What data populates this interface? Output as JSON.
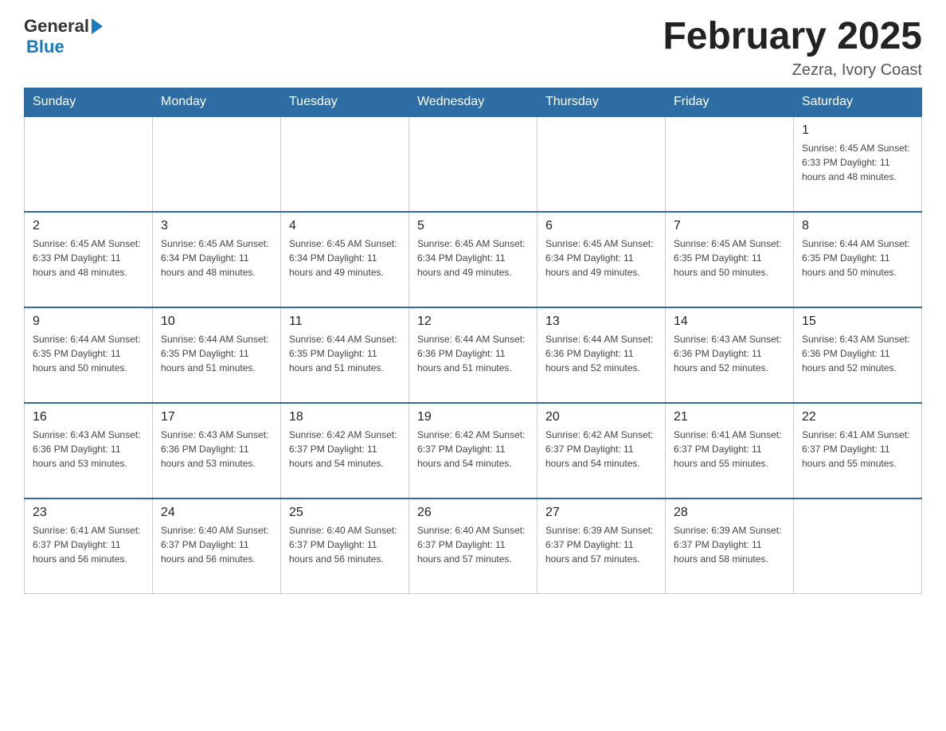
{
  "logo": {
    "general": "General",
    "blue": "Blue"
  },
  "title": "February 2025",
  "subtitle": "Zezra, Ivory Coast",
  "days_of_week": [
    "Sunday",
    "Monday",
    "Tuesday",
    "Wednesday",
    "Thursday",
    "Friday",
    "Saturday"
  ],
  "weeks": [
    [
      {
        "day": "",
        "info": ""
      },
      {
        "day": "",
        "info": ""
      },
      {
        "day": "",
        "info": ""
      },
      {
        "day": "",
        "info": ""
      },
      {
        "day": "",
        "info": ""
      },
      {
        "day": "",
        "info": ""
      },
      {
        "day": "1",
        "info": "Sunrise: 6:45 AM\nSunset: 6:33 PM\nDaylight: 11 hours\nand 48 minutes."
      }
    ],
    [
      {
        "day": "2",
        "info": "Sunrise: 6:45 AM\nSunset: 6:33 PM\nDaylight: 11 hours\nand 48 minutes."
      },
      {
        "day": "3",
        "info": "Sunrise: 6:45 AM\nSunset: 6:34 PM\nDaylight: 11 hours\nand 48 minutes."
      },
      {
        "day": "4",
        "info": "Sunrise: 6:45 AM\nSunset: 6:34 PM\nDaylight: 11 hours\nand 49 minutes."
      },
      {
        "day": "5",
        "info": "Sunrise: 6:45 AM\nSunset: 6:34 PM\nDaylight: 11 hours\nand 49 minutes."
      },
      {
        "day": "6",
        "info": "Sunrise: 6:45 AM\nSunset: 6:34 PM\nDaylight: 11 hours\nand 49 minutes."
      },
      {
        "day": "7",
        "info": "Sunrise: 6:45 AM\nSunset: 6:35 PM\nDaylight: 11 hours\nand 50 minutes."
      },
      {
        "day": "8",
        "info": "Sunrise: 6:44 AM\nSunset: 6:35 PM\nDaylight: 11 hours\nand 50 minutes."
      }
    ],
    [
      {
        "day": "9",
        "info": "Sunrise: 6:44 AM\nSunset: 6:35 PM\nDaylight: 11 hours\nand 50 minutes."
      },
      {
        "day": "10",
        "info": "Sunrise: 6:44 AM\nSunset: 6:35 PM\nDaylight: 11 hours\nand 51 minutes."
      },
      {
        "day": "11",
        "info": "Sunrise: 6:44 AM\nSunset: 6:35 PM\nDaylight: 11 hours\nand 51 minutes."
      },
      {
        "day": "12",
        "info": "Sunrise: 6:44 AM\nSunset: 6:36 PM\nDaylight: 11 hours\nand 51 minutes."
      },
      {
        "day": "13",
        "info": "Sunrise: 6:44 AM\nSunset: 6:36 PM\nDaylight: 11 hours\nand 52 minutes."
      },
      {
        "day": "14",
        "info": "Sunrise: 6:43 AM\nSunset: 6:36 PM\nDaylight: 11 hours\nand 52 minutes."
      },
      {
        "day": "15",
        "info": "Sunrise: 6:43 AM\nSunset: 6:36 PM\nDaylight: 11 hours\nand 52 minutes."
      }
    ],
    [
      {
        "day": "16",
        "info": "Sunrise: 6:43 AM\nSunset: 6:36 PM\nDaylight: 11 hours\nand 53 minutes."
      },
      {
        "day": "17",
        "info": "Sunrise: 6:43 AM\nSunset: 6:36 PM\nDaylight: 11 hours\nand 53 minutes."
      },
      {
        "day": "18",
        "info": "Sunrise: 6:42 AM\nSunset: 6:37 PM\nDaylight: 11 hours\nand 54 minutes."
      },
      {
        "day": "19",
        "info": "Sunrise: 6:42 AM\nSunset: 6:37 PM\nDaylight: 11 hours\nand 54 minutes."
      },
      {
        "day": "20",
        "info": "Sunrise: 6:42 AM\nSunset: 6:37 PM\nDaylight: 11 hours\nand 54 minutes."
      },
      {
        "day": "21",
        "info": "Sunrise: 6:41 AM\nSunset: 6:37 PM\nDaylight: 11 hours\nand 55 minutes."
      },
      {
        "day": "22",
        "info": "Sunrise: 6:41 AM\nSunset: 6:37 PM\nDaylight: 11 hours\nand 55 minutes."
      }
    ],
    [
      {
        "day": "23",
        "info": "Sunrise: 6:41 AM\nSunset: 6:37 PM\nDaylight: 11 hours\nand 56 minutes."
      },
      {
        "day": "24",
        "info": "Sunrise: 6:40 AM\nSunset: 6:37 PM\nDaylight: 11 hours\nand 56 minutes."
      },
      {
        "day": "25",
        "info": "Sunrise: 6:40 AM\nSunset: 6:37 PM\nDaylight: 11 hours\nand 56 minutes."
      },
      {
        "day": "26",
        "info": "Sunrise: 6:40 AM\nSunset: 6:37 PM\nDaylight: 11 hours\nand 57 minutes."
      },
      {
        "day": "27",
        "info": "Sunrise: 6:39 AM\nSunset: 6:37 PM\nDaylight: 11 hours\nand 57 minutes."
      },
      {
        "day": "28",
        "info": "Sunrise: 6:39 AM\nSunset: 6:37 PM\nDaylight: 11 hours\nand 58 minutes."
      },
      {
        "day": "",
        "info": ""
      }
    ]
  ]
}
